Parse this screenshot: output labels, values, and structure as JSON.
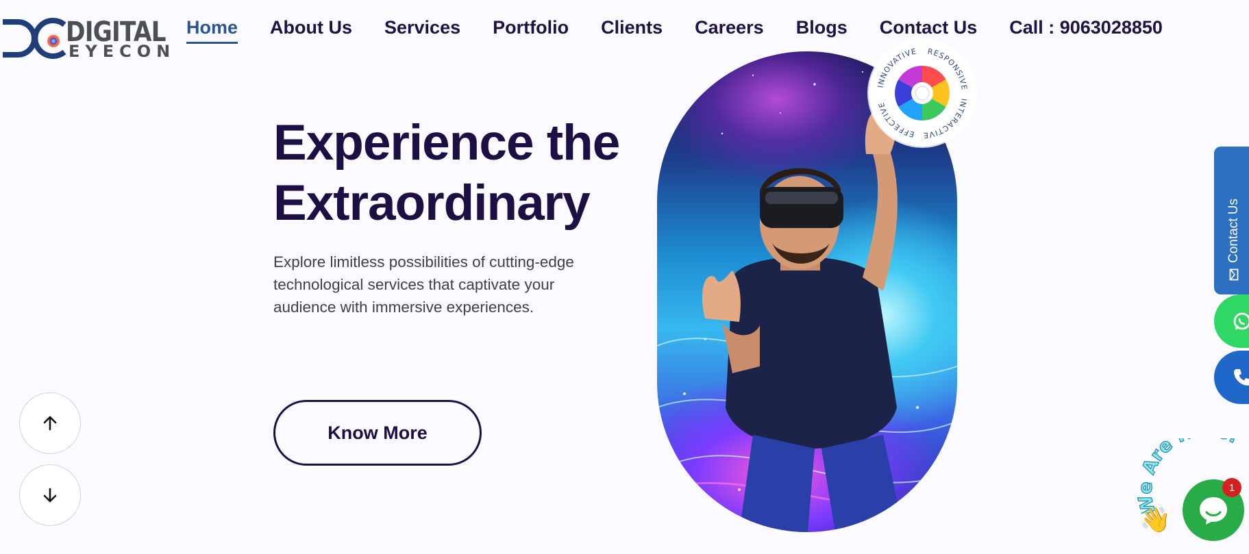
{
  "brand": {
    "logo_line1": "DIGITAL",
    "logo_line2": "EYECON"
  },
  "nav": {
    "items": [
      {
        "label": "Home",
        "active": true
      },
      {
        "label": "About Us"
      },
      {
        "label": "Services"
      },
      {
        "label": "Portfolio"
      },
      {
        "label": "Clients"
      },
      {
        "label": "Careers"
      },
      {
        "label": "Blogs"
      },
      {
        "label": "Contact Us"
      }
    ],
    "call": "Call : 9063028850"
  },
  "hero": {
    "title_line1": "Experience the",
    "title_line2": "Extraordinary",
    "description": "Explore limitless possibilities of cutting-edge technological services that captivate your audience with immersive experiences.",
    "cta": "Know More"
  },
  "seal": {
    "words": [
      "EFFECTIVE",
      "INNOVATIVE",
      "RESPONSIVE",
      "INTERACTIVE"
    ]
  },
  "side": {
    "contact_label": "Contact Us"
  },
  "chat": {
    "banner": "We Are Here!",
    "badge_count": "1"
  },
  "icons": {
    "scroll_up": "arrow-up-icon",
    "scroll_down": "arrow-down-icon",
    "whatsapp": "whatsapp-icon",
    "phone": "phone-icon",
    "mail": "mail-icon",
    "chat": "chat-icon",
    "wave": "waving-hand-icon"
  },
  "colors": {
    "primary_text": "#1d0f44",
    "nav_active": "#2b5590",
    "contact_tab": "#2d6fc0",
    "whatsapp": "#2fd865",
    "phone": "#1f67c9",
    "chat": "#27ac48",
    "badge": "#d71f1f"
  }
}
